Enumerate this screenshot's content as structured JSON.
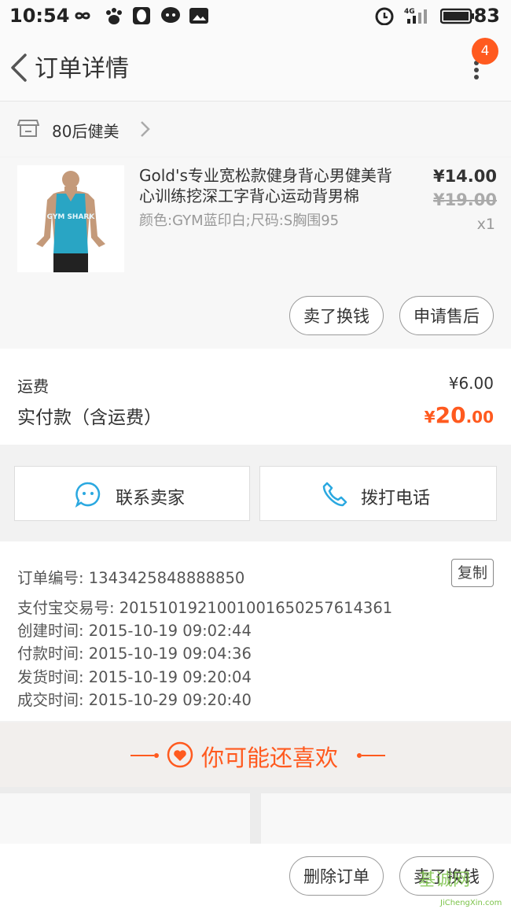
{
  "status_bar": {
    "time": "10:54",
    "battery": "83",
    "network": "4G"
  },
  "nav": {
    "title": "订单详情",
    "badge": "4"
  },
  "shop": {
    "name": "80后健美"
  },
  "product": {
    "title": "Gold's专业宽松款健身背心男健美背心训练挖深工字背心运动背男棉",
    "spec": "颜色:GYM蓝印白;尺码:S胸围95",
    "price": "¥14.00",
    "old_price": "¥19.00",
    "qty": "x1",
    "image_text": "GYM SHARK"
  },
  "actions": {
    "sell_label": "卖了换钱",
    "after_sale_label": "申请售后"
  },
  "fees": {
    "shipping_label": "运费",
    "shipping_value": "¥6.00",
    "paid_label": "实付款（含运费）",
    "paid_symbol": "¥",
    "paid_int": "20",
    "paid_dec": ".00"
  },
  "contact": {
    "seller_label": "联系卖家",
    "phone_label": "拨打电话"
  },
  "order_info": {
    "copy_label": "复制",
    "lines": [
      "订单编号: 1343425848888850",
      "支付宝交易号: 2015101921001001650257614361",
      "创建时间: 2015-10-19 09:02:44",
      "付款时间: 2015-10-19 09:04:36",
      "发货时间: 2015-10-19 09:20:04",
      "成交时间: 2015-10-29 09:20:40"
    ]
  },
  "recommend": {
    "title": "你可能还喜欢"
  },
  "bottom": {
    "delete_label": "删除订单",
    "sell_label": "卖了换钱"
  },
  "watermark": {
    "text": "基诚网",
    "url": "JiChengXin.com"
  },
  "colors": {
    "accent": "#ff5a1f",
    "icon_blue": "#2aa8e0"
  }
}
